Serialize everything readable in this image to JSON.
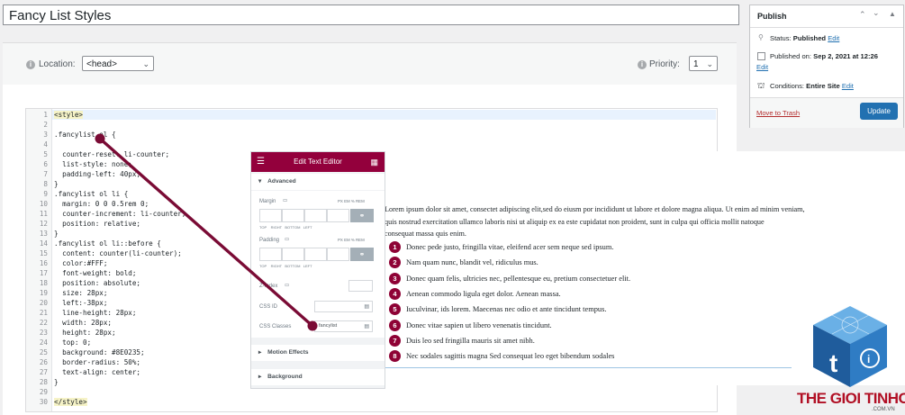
{
  "title": "Fancy List Styles",
  "location": {
    "label": "Location:",
    "value": "<head>"
  },
  "priority": {
    "label": "Priority:",
    "value": "1"
  },
  "code": [
    {
      "n": "1",
      "t": "<style>",
      "hl": true
    },
    {
      "n": "2",
      "t": ""
    },
    {
      "n": "3",
      "t": ".fancylist ol {"
    },
    {
      "n": "4",
      "t": ""
    },
    {
      "n": "5",
      "t": "  counter-reset: li-counter;"
    },
    {
      "n": "6",
      "t": "  list-style: none;"
    },
    {
      "n": "7",
      "t": "  padding-left: 40px;"
    },
    {
      "n": "8",
      "t": "}"
    },
    {
      "n": "9",
      "t": ".fancylist ol li {"
    },
    {
      "n": "10",
      "t": "  margin: 0 0 0.5rem 0;"
    },
    {
      "n": "11",
      "t": "  counter-increment: li-counter;"
    },
    {
      "n": "12",
      "t": "  position: relative;"
    },
    {
      "n": "13",
      "t": "}"
    },
    {
      "n": "14",
      "t": ".fancylist ol li::before {"
    },
    {
      "n": "15",
      "t": "  content: counter(li-counter);"
    },
    {
      "n": "16",
      "t": "  color:#FFF;"
    },
    {
      "n": "17",
      "t": "  font-weight: bold;"
    },
    {
      "n": "18",
      "t": "  position: absolute;"
    },
    {
      "n": "19",
      "t": "  size: 28px;"
    },
    {
      "n": "20",
      "t": "  left:-38px;"
    },
    {
      "n": "21",
      "t": "  line-height: 28px;"
    },
    {
      "n": "22",
      "t": "  width: 28px;"
    },
    {
      "n": "23",
      "t": "  height: 28px;"
    },
    {
      "n": "24",
      "t": "  top: 0;"
    },
    {
      "n": "25",
      "t": "  background: #8E0235;"
    },
    {
      "n": "26",
      "t": "  border-radius: 50%;"
    },
    {
      "n": "27",
      "t": "  text-align: center;"
    },
    {
      "n": "28",
      "t": "}"
    },
    {
      "n": "29",
      "t": ""
    },
    {
      "n": "30",
      "t": "</style>",
      "hl": true
    }
  ],
  "publish": {
    "heading": "Publish",
    "status_label": "Status:",
    "status_value": "Published",
    "published_label": "Published on:",
    "published_value": "Sep 2, 2021 at 12:26",
    "conditions_label": "Conditions:",
    "conditions_value": "Entire Site",
    "edit": "Edit",
    "trash": "Move to Trash",
    "update": "Update"
  },
  "elementor": {
    "title": "Edit Text Editor",
    "advanced": "Advanced",
    "margin": "Margin",
    "padding": "Padding",
    "zindex": "Z-Index",
    "css_id": "CSS ID",
    "css_classes": "CSS Classes",
    "css_classes_value": "fancylist",
    "motion": "Motion Effects",
    "background": "Background",
    "units": [
      "PX",
      "EM",
      "%",
      "REM"
    ],
    "sides": [
      "TOP",
      "RIGHT",
      "BOTTOM",
      "LEFT"
    ]
  },
  "preview": {
    "paragraph": [
      "Lorem ipsum dolor sit amet, consectet adipiscing elit,sed do eiusm por incididunt ut labore et dolore magna aliqua. Ut enim ad minim veniam,",
      "quis nostrud exercitation ullamco laboris nisi ut aliquip ex ea este cupidatat non proident, sunt in culpa qui officia mollit natoque",
      "consequat massa quis enim."
    ],
    "items": [
      {
        "n": "1",
        "t": "Donec pede justo, fringilla vitae, eleifend acer sem neque sed ipsum."
      },
      {
        "n": "2",
        "t": "Nam quam nunc, blandit vel, ridiculus mus."
      },
      {
        "n": "3",
        "t": "Donec quam felis, ultricies nec, pellentesque eu, pretium consectetuer elit."
      },
      {
        "n": "4",
        "t": "Aenean commodo ligula eget dolor. Aenean massa."
      },
      {
        "n": "5",
        "t": "Iuculvinar, ids lorem. Maecenas nec odio et ante tincidunt tempus."
      },
      {
        "n": "6",
        "t": "Donec vitae sapien ut libero venenatis tincidunt."
      },
      {
        "n": "7",
        "t": "Duis leo sed fringilla mauris sit amet nibh."
      },
      {
        "n": "8",
        "t": "Nec sodales sagittis magna Sed consequat leo eget bibendum sodales"
      }
    ]
  },
  "logo": {
    "brand": "THE GIOI TINHOC",
    "domain": ".COM.VN"
  },
  "colors": {
    "accent": "#8e0235",
    "wp_blue": "#2271b1",
    "trash": "#b32d2e"
  }
}
